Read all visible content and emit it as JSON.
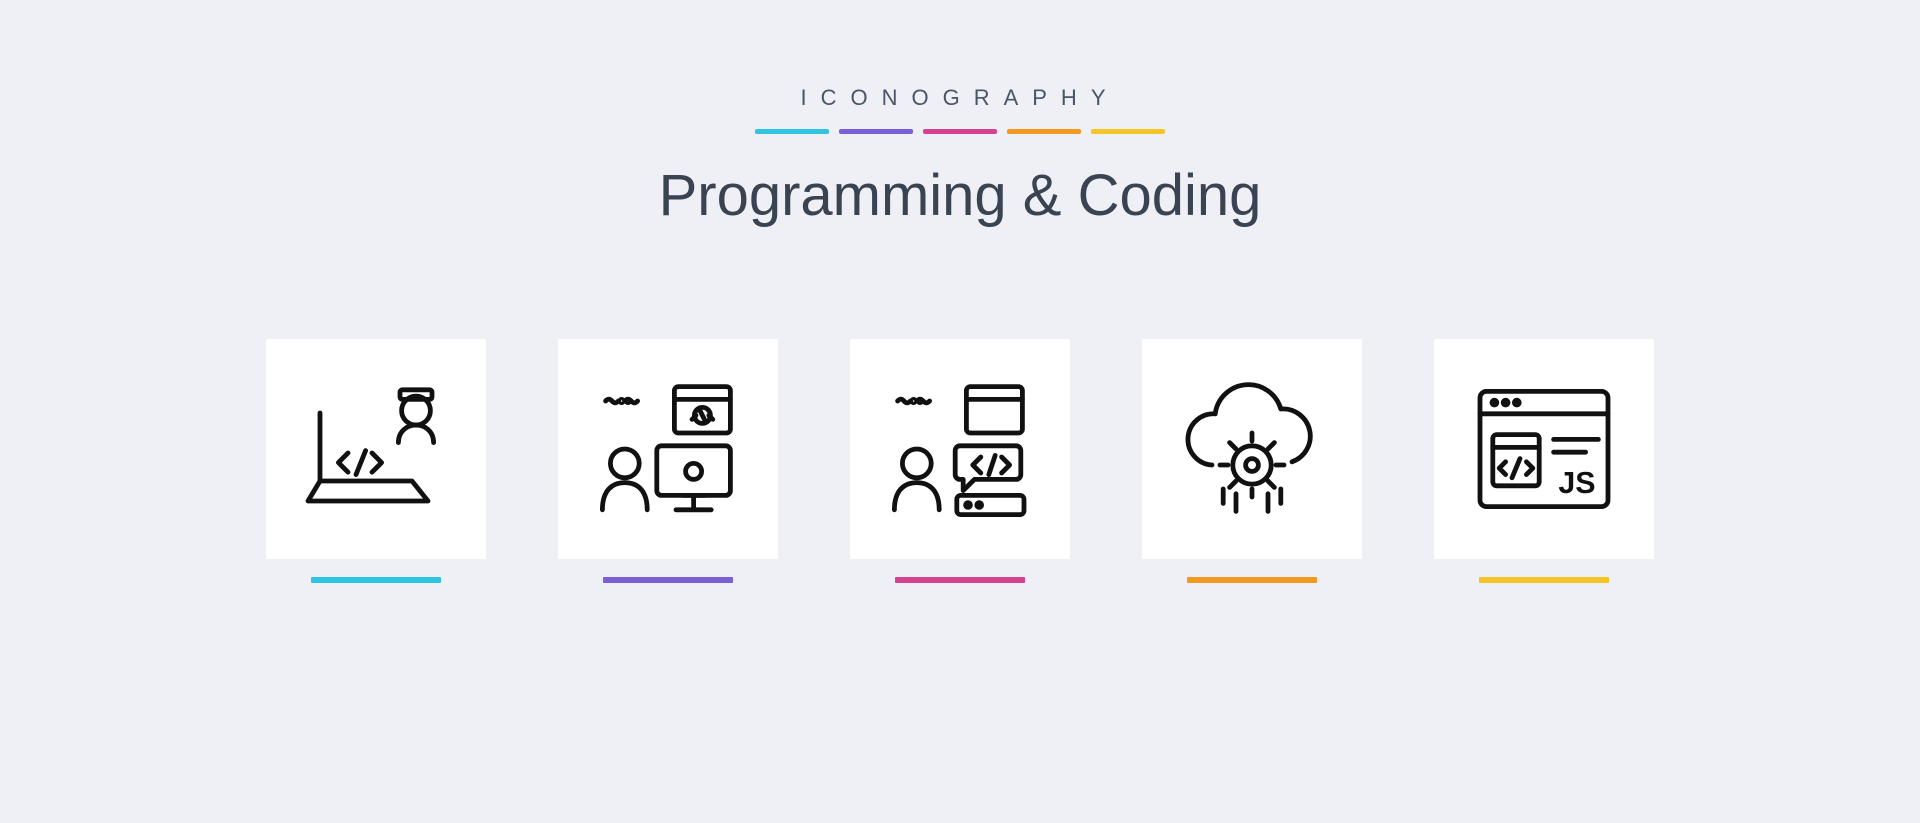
{
  "header": {
    "overline": "ICONOGRAPHY",
    "title": "Programming & Coding",
    "underlineColors": [
      "#2fc4e0",
      "#7b5fd6",
      "#d6428f",
      "#f29a1f",
      "#f5c525"
    ]
  },
  "icons": [
    {
      "name": "laptop-developer-icon",
      "underline": "#2fc4e0"
    },
    {
      "name": "user-desktop-code-icon",
      "underline": "#7b5fd6"
    },
    {
      "name": "user-server-code-icon",
      "underline": "#d6428f"
    },
    {
      "name": "cloud-gear-icon",
      "underline": "#f29a1f"
    },
    {
      "name": "browser-js-icon",
      "underline": "#f5c525"
    }
  ]
}
